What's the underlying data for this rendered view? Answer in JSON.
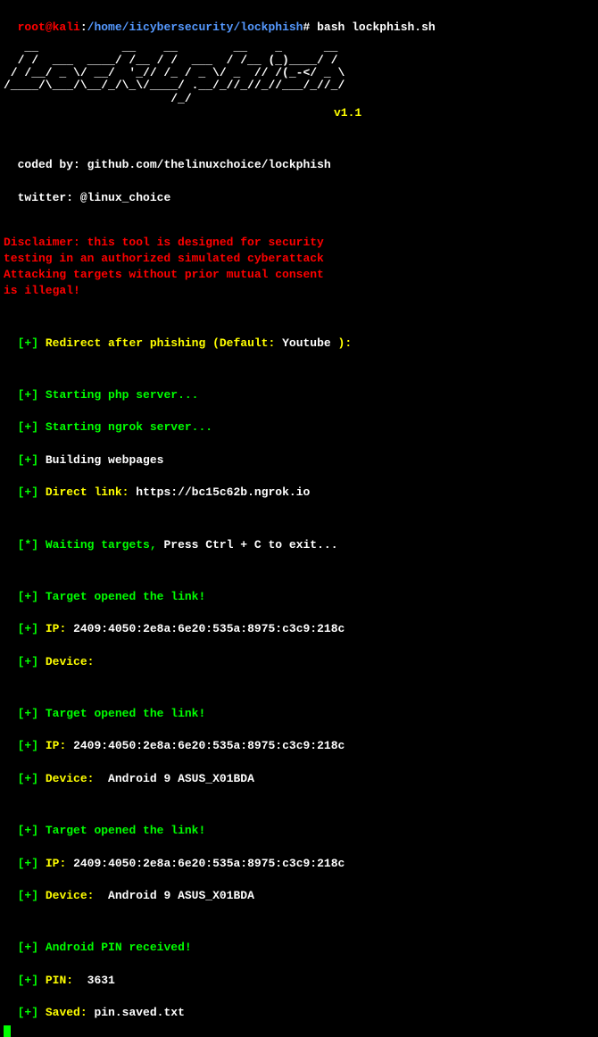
{
  "prompt": {
    "user": "root@kali",
    "sep1": ":",
    "path": "/home/iicybersecurity/lockphish",
    "sep2": "# ",
    "command": "bash lockphish.sh"
  },
  "ascii": "   __            __    __        __    _      __\n  / /  ___  ____/ /__ / /  ___  / /__ (_)____/ /\n / /__/ _ \\/ __/  '_// /_ / _ \\/ _  // /(_-</ _ \\\n/____/\\___/\\__/_/\\_\\/____/ .__/_//_//_//___/_//_/\n                        /_/",
  "version": "v1.1",
  "credits": {
    "codedby_label": "coded by: ",
    "codedby_value": "github.com/thelinuxchoice/lockphish",
    "twitter_label": "twitter: ",
    "twitter_value": "@linux_choice"
  },
  "disclaimer": {
    "l1": "Disclaimer: this tool is designed for security",
    "l2": "testing in an authorized simulated cyberattack",
    "l3": "Attacking targets without prior mutual consent",
    "l4": "is illegal!"
  },
  "redirect": {
    "label": "Redirect after phishing (Default: ",
    "value": "Youtube ",
    "close": "):"
  },
  "start": {
    "php": "Starting php server...",
    "ngrok": "Starting ngrok server...",
    "build": "Building webpages",
    "link_label": "Direct link: ",
    "link_value": "https://bc15c62b.ngrok.io"
  },
  "waiting": {
    "label": "Waiting targets, ",
    "exit": "Press Ctrl + C to exit..."
  },
  "hits": [
    {
      "opened": "Target opened the link!",
      "ip_label": "IP: ",
      "ip_value": "2409:4050:2e8a:6e20:535a:8975:c3c9:218c",
      "device_label": "Device:",
      "device_value": ""
    },
    {
      "opened": "Target opened the link!",
      "ip_label": "IP: ",
      "ip_value": "2409:4050:2e8a:6e20:535a:8975:c3c9:218c",
      "device_label": "Device:",
      "device_value": "  Android 9 ASUS_X01BDA"
    },
    {
      "opened": "Target opened the link!",
      "ip_label": "IP: ",
      "ip_value": "2409:4050:2e8a:6e20:535a:8975:c3c9:218c",
      "device_label": "Device:",
      "device_value": "  Android 9 ASUS_X01BDA"
    }
  ],
  "pin": {
    "received": "Android PIN received!",
    "pin_label": "PIN:  ",
    "pin_value": "3631",
    "saved_label": "Saved: ",
    "saved_value": "pin.saved.txt"
  },
  "tokens": {
    "plus_open": "[",
    "plus_sign": "+",
    "plus_close": "] ",
    "star_open": "[",
    "star_sign": "*",
    "star_close": "] "
  }
}
